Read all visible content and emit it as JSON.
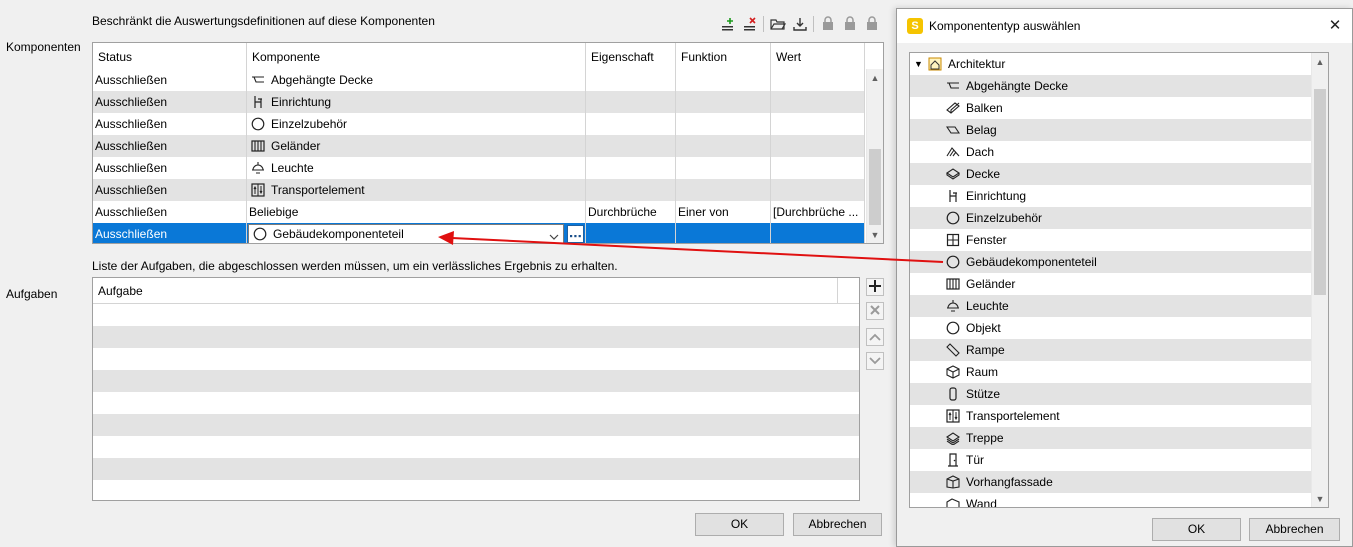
{
  "header": {
    "restrict_text": "Beschränkt die Auswertungsdefinitionen auf diese Komponenten",
    "komponenten_label": "Komponenten",
    "aufgaben_label": "Aufgaben",
    "aufgaben_hint": "Liste der Aufgaben, die abgeschlossen werden müssen, um ein verlässliches Ergebnis zu erhalten."
  },
  "toolbar": {
    "icons": [
      "add-row-icon",
      "delete-row-icon",
      "open-folder-icon",
      "download-icon",
      "lock-icon",
      "lock-icon",
      "lock-icon"
    ]
  },
  "components_table": {
    "columns": [
      "Status",
      "Komponente",
      "Eigenschaft",
      "Funktion",
      "Wert"
    ],
    "rows": [
      {
        "status": "Ausschließen",
        "component": "Abgehängte Decke",
        "icon": "suspended-ceiling-icon",
        "property": "",
        "function": "",
        "value": ""
      },
      {
        "status": "Ausschließen",
        "component": "Einrichtung",
        "icon": "furniture-icon",
        "property": "",
        "function": "",
        "value": ""
      },
      {
        "status": "Ausschließen",
        "component": "Einzelzubehör",
        "icon": "circle-icon",
        "property": "",
        "function": "",
        "value": ""
      },
      {
        "status": "Ausschließen",
        "component": "Geländer",
        "icon": "railing-icon",
        "property": "",
        "function": "",
        "value": ""
      },
      {
        "status": "Ausschließen",
        "component": "Leuchte",
        "icon": "lamp-icon",
        "property": "",
        "function": "",
        "value": ""
      },
      {
        "status": "Ausschließen",
        "component": "Transportelement",
        "icon": "elevator-icon",
        "property": "",
        "function": "",
        "value": ""
      },
      {
        "status": "Ausschließen",
        "component": "Beliebige",
        "icon": "",
        "property": "Durchbrüche",
        "function": "Einer von",
        "value": "[Durchbrüche ..."
      },
      {
        "status": "Ausschließen",
        "component": "Gebäudekomponenteteil",
        "icon": "circle-icon",
        "property": "",
        "function": "",
        "value": ""
      }
    ]
  },
  "tasks_table": {
    "columns": [
      "Aufgabe"
    ],
    "rows": [
      "",
      "",
      "",
      "",
      "",
      "",
      "",
      "",
      ""
    ]
  },
  "buttons": {
    "ok": "OK",
    "cancel": "Abbrechen"
  },
  "dialog": {
    "title": "Komponententyp auswählen",
    "app_icon_letter": "S",
    "close_symbol": "✕",
    "root": "Architektur",
    "items": [
      {
        "label": "Abgehängte Decke",
        "icon": "suspended-ceiling-icon"
      },
      {
        "label": "Balken",
        "icon": "beam-icon"
      },
      {
        "label": "Belag",
        "icon": "covering-icon"
      },
      {
        "label": "Dach",
        "icon": "roof-icon"
      },
      {
        "label": "Decke",
        "icon": "slab-icon"
      },
      {
        "label": "Einrichtung",
        "icon": "furniture-icon"
      },
      {
        "label": "Einzelzubehör",
        "icon": "circle-icon"
      },
      {
        "label": "Fenster",
        "icon": "window-icon"
      },
      {
        "label": "Gebäudekomponenteteil",
        "icon": "circle-icon"
      },
      {
        "label": "Geländer",
        "icon": "railing-icon"
      },
      {
        "label": "Leuchte",
        "icon": "lamp-icon"
      },
      {
        "label": "Objekt",
        "icon": "circle-icon"
      },
      {
        "label": "Rampe",
        "icon": "ramp-icon"
      },
      {
        "label": "Raum",
        "icon": "space-icon"
      },
      {
        "label": "Stütze",
        "icon": "column-icon"
      },
      {
        "label": "Transportelement",
        "icon": "elevator-icon"
      },
      {
        "label": "Treppe",
        "icon": "stair-icon"
      },
      {
        "label": "Tür",
        "icon": "door-icon"
      },
      {
        "label": "Vorhangfassade",
        "icon": "curtain-wall-icon"
      },
      {
        "label": "Wand",
        "icon": "wall-icon"
      }
    ],
    "ok": "OK",
    "cancel": "Abbrechen"
  },
  "colors": {
    "selection": "#0a78d7",
    "arrow": "#e01010",
    "app_icon": "#f5c400"
  }
}
